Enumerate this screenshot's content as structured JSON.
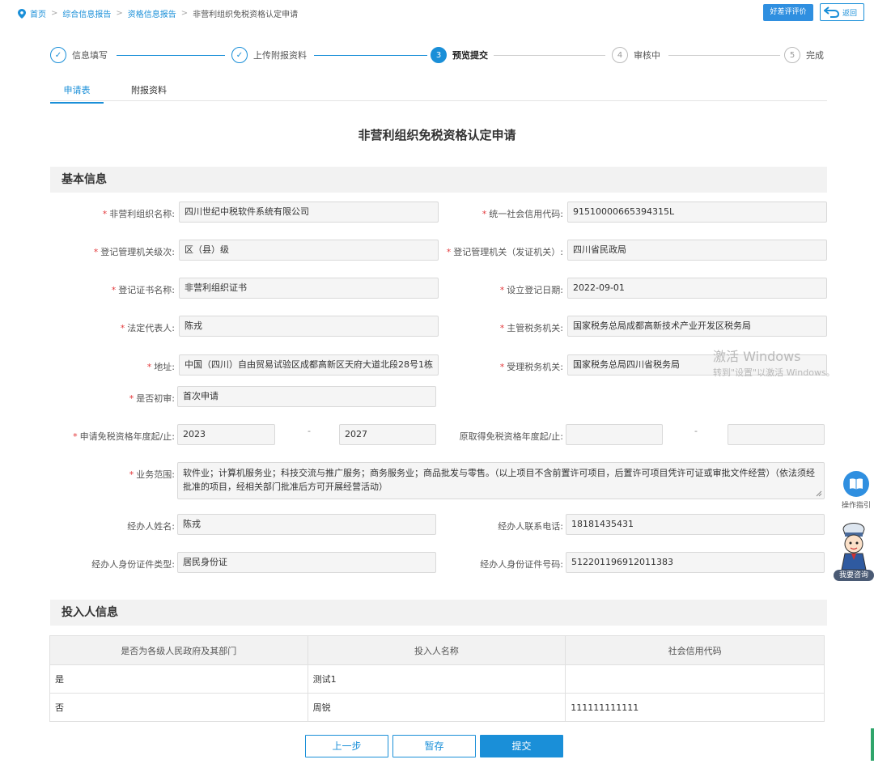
{
  "breadcrumb": {
    "home": "首页",
    "items": [
      "综合信息报告",
      "资格信息报告"
    ],
    "current": "非营利组织免税资格认定申请",
    "separator": ">"
  },
  "header": {
    "eval_label": "好差评评价",
    "back_label": "返回"
  },
  "steps": [
    {
      "num": "✓",
      "label": "信息填写",
      "state": "done"
    },
    {
      "num": "✓",
      "label": "上传附报资料",
      "state": "done"
    },
    {
      "num": "3",
      "label": "预览提交",
      "state": "active"
    },
    {
      "num": "4",
      "label": "审核中",
      "state": "todo"
    },
    {
      "num": "5",
      "label": "完成",
      "state": "todo"
    }
  ],
  "tabs": [
    "申请表",
    "附报资料"
  ],
  "form_title": "非营利组织免税资格认定申请",
  "basic": {
    "title": "基本信息",
    "org_name_label": "非营利组织名称:",
    "org_name": "四川世纪中税软件系统有限公司",
    "credit_code_label": "统一社会信用代码:",
    "credit_code": "91510000665394315L",
    "reg_level_label": "登记管理机关级次:",
    "reg_level": "区（县）级",
    "reg_authority_label": "登记管理机关（发证机关）:",
    "reg_authority": "四川省民政局",
    "cert_name_label": "登记证书名称:",
    "cert_name": "非营利组织证书",
    "reg_date_label": "设立登记日期:",
    "reg_date": "2022-09-01",
    "legal_rep_label": "法定代表人:",
    "legal_rep": "陈戎",
    "tax_office_label": "主管税务机关:",
    "tax_office": "国家税务总局成都高新技术产业开发区税务局",
    "address_label": "地址:",
    "address": "中国（四川）自由贸易试验区成都高新区天府大道北段28号1栋",
    "accept_office_label": "受理税务机关:",
    "accept_office": "国家税务总局四川省税务局",
    "first_apply_label": "是否初审:",
    "first_apply": "首次申请",
    "years_label": "申请免税资格年度起/止:",
    "year_start": "2023",
    "year_end": "2027",
    "orig_years_label": "原取得免税资格年度起/止:",
    "orig_year_start": "",
    "orig_year_end": "",
    "range_dash": "-",
    "scope_label": "业务范围:",
    "scope": "软件业；计算机服务业；科技交流与推广服务；商务服务业；商品批发与零售。（以上项目不含前置许可项目，后置许可项目凭许可证或审批文件经营）（依法须经批准的项目，经相关部门批准后方可开展经营活动）",
    "agent_name_label": "经办人姓名:",
    "agent_name": "陈戎",
    "agent_phone_label": "经办人联系电话:",
    "agent_phone": "18181435431",
    "agent_id_type_label": "经办人身份证件类型:",
    "agent_id_type": "居民身份证",
    "agent_id_no_label": "经办人身份证件号码:",
    "agent_id_no": "512201196912011383"
  },
  "investors": {
    "title": "投入人信息",
    "columns": [
      "是否为各级人民政府及其部门",
      "投入人名称",
      "社会信用代码"
    ],
    "rows": [
      [
        "是",
        "测试1",
        ""
      ],
      [
        "否",
        "周锐",
        "111111111111"
      ]
    ]
  },
  "buttons": {
    "prev": "上一步",
    "save": "暂存",
    "submit": "提交"
  },
  "watermark": {
    "line1": "激活 Windows",
    "line2": "转到\"设置\"以激活 Windows。"
  },
  "side": {
    "guide_label": "操作指引",
    "consult_label": "我要咨询"
  },
  "colors": {
    "accent": "#1a8fd8",
    "required": "#e4393c"
  }
}
